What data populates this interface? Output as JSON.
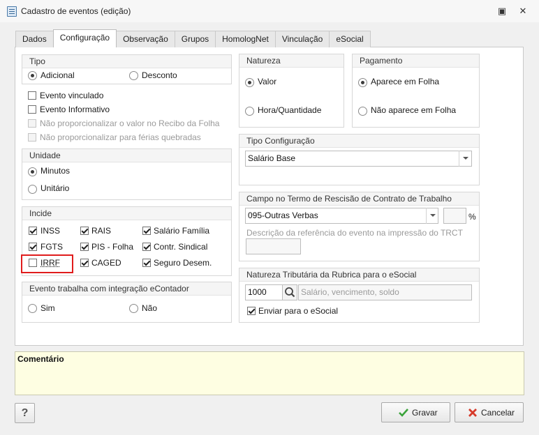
{
  "window": {
    "title": "Cadastro de eventos (edição)",
    "restore_glyph": "▣",
    "close_glyph": "✕"
  },
  "tabs": [
    {
      "label": "Dados"
    },
    {
      "label": "Configuração"
    },
    {
      "label": "Observação"
    },
    {
      "label": "Grupos"
    },
    {
      "label": "HomologNet"
    },
    {
      "label": "Vinculação"
    },
    {
      "label": "eSocial"
    }
  ],
  "tipo": {
    "title": "Tipo",
    "adicional": "Adicional",
    "desconto": "Desconto",
    "selected": "Adicional"
  },
  "flags": {
    "evento_vinculado": "Evento vinculado",
    "evento_informativo": "Evento Informativo",
    "nao_prop_recibo": "Não proporcionalizar o valor no Recibo da Folha",
    "nao_prop_ferias": "Não proporcionalizar para férias quebradas"
  },
  "unidade": {
    "title": "Unidade",
    "minutos": "Minutos",
    "unitario": "Unitário",
    "selected": "Minutos"
  },
  "incide": {
    "title": "Incide",
    "inss": "INSS",
    "rais": "RAIS",
    "salario_familia": "Salário Família",
    "fgts": "FGTS",
    "pis_folha": "PIS - Folha",
    "contr_sindical": "Contr. Sindical",
    "irrf": "IRRF",
    "caged": "CAGED",
    "seguro_desem": "Seguro Desem."
  },
  "econtador": {
    "title": "Evento trabalha com integração eContador",
    "sim": "Sim",
    "nao": "Não"
  },
  "natureza": {
    "title": "Natureza",
    "valor": "Valor",
    "hora_quantidade": "Hora/Quantidade",
    "selected": "Valor"
  },
  "pagamento": {
    "title": "Pagamento",
    "aparece": "Aparece em Folha",
    "nao_aparece": "Não aparece em Folha",
    "selected": "Aparece em Folha"
  },
  "tipo_config": {
    "title": "Tipo Configuração",
    "value": "Salário Base"
  },
  "rescisao": {
    "title": "Campo no Termo de Rescisão de Contrato de Trabalho",
    "value": "095-Outras Verbas",
    "percent_symbol": "%",
    "percent_value": "",
    "desc_label": "Descrição da referência do evento na impressão do TRCT",
    "desc_value": ""
  },
  "esocial": {
    "title": "Natureza Tributária da Rubrica para o eSocial",
    "code": "1000",
    "description": "Salário, vencimento, soldo",
    "enviar": "Enviar para o eSocial"
  },
  "comment": {
    "title": "Comentário"
  },
  "buttons": {
    "help": "?",
    "gravar": "Gravar",
    "cancelar": "Cancelar"
  },
  "colors": {
    "highlight": "#e01c1c",
    "comment_bg": "#fefee2",
    "check_green": "#3aa33a",
    "cancel_red": "#d63a2a"
  }
}
